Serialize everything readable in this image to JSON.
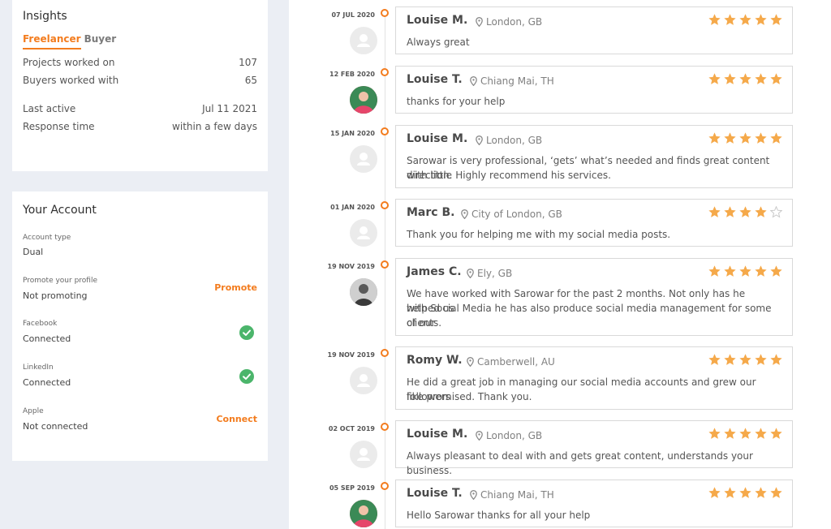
{
  "insights": {
    "title": "Insights",
    "tabs": [
      "Freelancer",
      "Buyer"
    ],
    "stats": [
      {
        "label": "Projects worked on",
        "value": "107"
      },
      {
        "label": "Buyers worked with",
        "value": "65"
      },
      {
        "label": "Last active",
        "value": "Jul 11 2021"
      },
      {
        "label": "Response time",
        "value": "within a few days"
      }
    ]
  },
  "account": {
    "title": "Your Account",
    "rows": [
      {
        "label": "Account type",
        "value": "Dual"
      },
      {
        "label": "Promote your profile",
        "value": "Not promoting",
        "action": "Promote"
      },
      {
        "label": "Facebook",
        "value": "Connected",
        "status_icon": "check-icon"
      },
      {
        "label": "LinkedIn",
        "value": "Connected",
        "status_icon": "check-icon"
      },
      {
        "label": "Apple",
        "value": "Not connected",
        "action": "Connect"
      }
    ]
  },
  "colors": {
    "accent": "#f37c1e",
    "star": "#f5a94a",
    "success": "#4bb56b"
  },
  "reviews": [
    {
      "date": "07 JUL 2020",
      "name": "Louise M.",
      "location": "London, GB",
      "rating": 5,
      "avatar": "placeholder",
      "text": [
        "Always great"
      ]
    },
    {
      "date": "12 FEB 2020",
      "name": "Louise T.",
      "location": "Chiang Mai, TH",
      "rating": 5,
      "avatar": "photo",
      "text": [
        "thanks for your help"
      ]
    },
    {
      "date": "15 JAN 2020",
      "name": "Louise M.",
      "location": "London, GB",
      "rating": 5,
      "avatar": "placeholder",
      "text": [
        "Sarowar is very professional, ‘gets’ what’s needed and finds great content with little",
        "direction. Highly recommend his services."
      ]
    },
    {
      "date": "01 JAN 2020",
      "name": "Marc B.",
      "location": "City of London, GB",
      "rating": 4,
      "avatar": "placeholder",
      "text": [
        "Thank you for helping me with my social media posts."
      ]
    },
    {
      "date": "19 NOV 2019",
      "name": "James C.",
      "location": "Ely, GB",
      "rating": 5,
      "avatar": "photo",
      "text": [
        "We have worked with Sarowar for the past 2 months. Not only has he helped us",
        "with Social Media he has also produce social media management for some of our",
        "clients."
      ]
    },
    {
      "date": "19 NOV 2019",
      "name": "Romy W.",
      "location": "Camberwell, AU",
      "rating": 5,
      "avatar": "placeholder",
      "text": [
        "He did a great job in managing our social media accounts and grew our followers",
        "like promised. Thank you."
      ]
    },
    {
      "date": "02 OCT 2019",
      "name": "Louise M.",
      "location": "London, GB",
      "rating": 5,
      "avatar": "placeholder",
      "text": [
        "Always pleasant to deal with and gets great content, understands your business."
      ]
    },
    {
      "date": "05 SEP 2019",
      "name": "Louise T.",
      "location": "Chiang Mai, TH",
      "rating": 5,
      "avatar": "photo",
      "text": [
        "Hello Sarowar thanks for all your help"
      ]
    }
  ]
}
